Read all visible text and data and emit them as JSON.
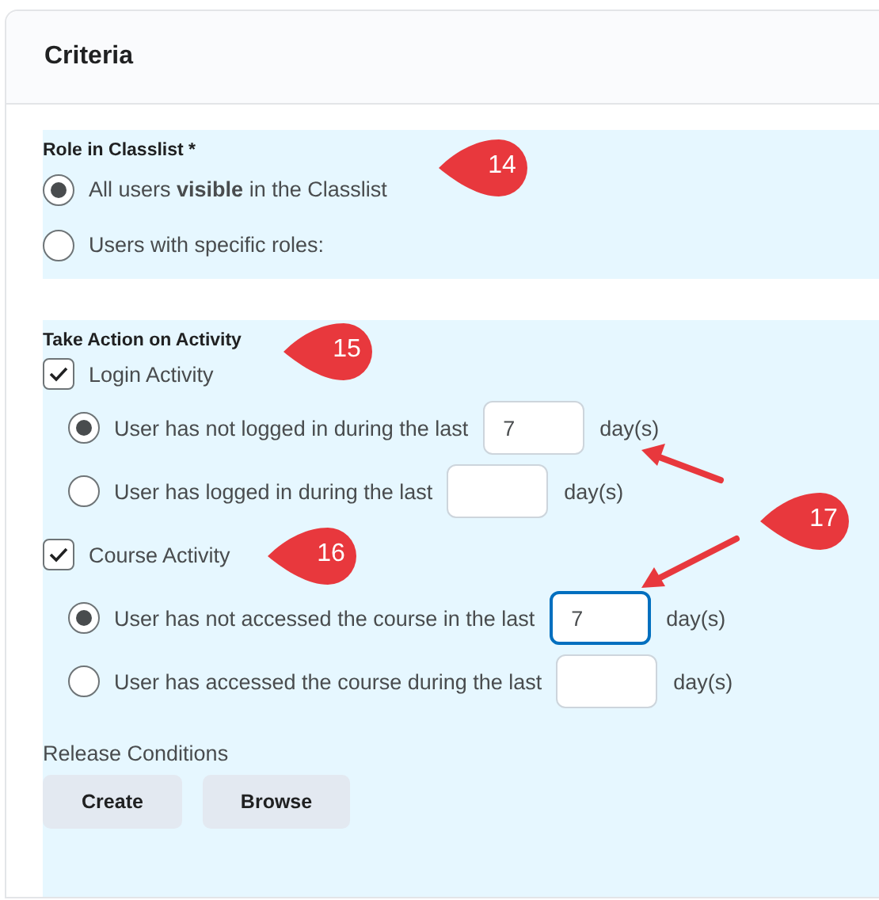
{
  "panel": {
    "title": "Criteria"
  },
  "role_section": {
    "label": "Role in Classlist *",
    "options": [
      {
        "label": "All users **visible** in the Classlist",
        "selected": true
      },
      {
        "label": "Users with specific roles:",
        "selected": false
      }
    ]
  },
  "activity_section": {
    "label": "Take Action on Activity",
    "groups": [
      {
        "label": "Login Activity",
        "checked": true,
        "options": [
          {
            "label": "User has not logged in during the last",
            "value": "7",
            "unit": "day(s)",
            "selected": true,
            "focused": false
          },
          {
            "label": "User has logged in during the last",
            "unit": "day(s)",
            "selected": false,
            "focused": false
          }
        ]
      },
      {
        "label": "Course Activity",
        "checked": true,
        "options": [
          {
            "label": "User has not accessed the course in the last",
            "value": "7",
            "unit": "day(s)",
            "selected": true,
            "focused": true
          },
          {
            "label": "User has accessed the course during the last",
            "unit": "day(s)",
            "selected": false,
            "focused": false
          }
        ]
      }
    ]
  },
  "release_conditions": {
    "label": "Release Conditions",
    "buttons": [
      "Create",
      "Browse"
    ]
  },
  "callouts": [
    "14",
    "15",
    "16",
    "17"
  ]
}
